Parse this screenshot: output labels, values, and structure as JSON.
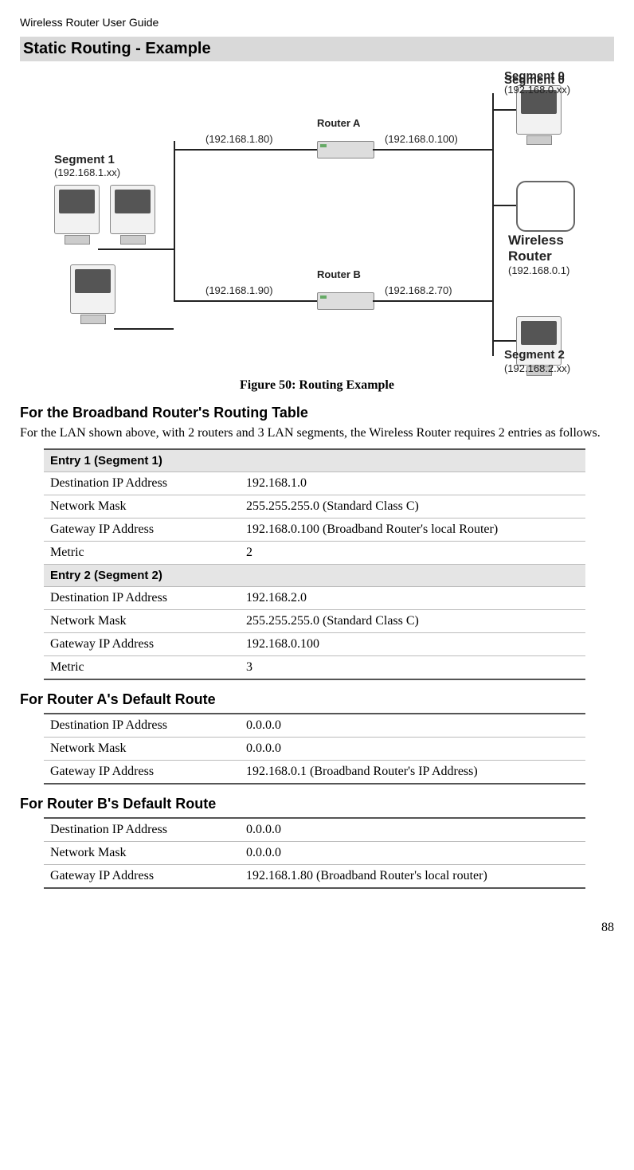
{
  "header": "Wireless Router User Guide",
  "section_title": "Static Routing - Example",
  "diagram": {
    "seg1_title": "Segment 1",
    "seg1_ip": "(192.168.1.xx)",
    "ra_left": "(192.168.1.80)",
    "ra_label": "Router A",
    "ra_right": "(192.168.0.100)",
    "rb_left": "(192.168.1.90)",
    "rb_label": "Router B",
    "rb_right": "(192.168.2.70)",
    "seg0_title": "Segment 0",
    "seg0_ip": "(192.168.0.xx)",
    "wr_title": "Wireless",
    "wr_title2": "Router",
    "wr_ip": "(192.168.0.1)",
    "seg2_title": "Segment 2",
    "seg2_ip": "(192.168.2.xx)"
  },
  "caption": "Figure 50: Routing Example",
  "sub1": "For the Broadband Router's Routing Table",
  "para1": "For the LAN shown above, with 2 routers and 3 LAN segments, the Wireless Router requires 2 entries as follows.",
  "table1": {
    "entry1": "Entry 1 (Segment 1)",
    "r1a": "Destination IP Address",
    "r1b": "192.168.1.0",
    "r2a": "Network Mask",
    "r2b": "255.255.255.0  (Standard Class C)",
    "r3a": "Gateway IP Address",
    "r3b": "192.168.0.100  (Broadband Router's local Router)",
    "r4a": "Metric",
    "r4b": "2",
    "entry2": "Entry 2  (Segment 2)",
    "r5a": "Destination IP Address",
    "r5b": "192.168.2.0",
    "r6a": "Network Mask",
    "r6b": "255.255.255.0  (Standard Class C)",
    "r7a": "Gateway IP Address",
    "r7b": "192.168.0.100",
    "r8a": "Metric",
    "r8b": "3"
  },
  "sub2": "For Router A's Default Route",
  "table2": {
    "r1a": "Destination IP Address",
    "r1b": "0.0.0.0",
    "r2a": "Network Mask",
    "r2b": "0.0.0.0",
    "r3a": "Gateway IP Address",
    "r3b": "192.168.0.1  (Broadband Router's IP Address)"
  },
  "sub3": "For Router B's Default Route",
  "table3": {
    "r1a": "Destination IP Address",
    "r1b": "0.0.0.0",
    "r2a": "Network Mask",
    "r2b": "0.0.0.0",
    "r3a": "Gateway IP Address",
    "r3b": "192.168.1.80 (Broadband Router's local router)"
  },
  "page": "88"
}
